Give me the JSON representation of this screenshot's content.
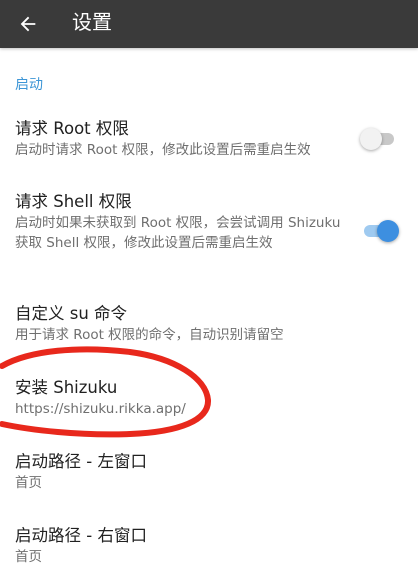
{
  "appbar": {
    "back_icon": "arrow-left-icon",
    "title": "设置"
  },
  "category": {
    "label": "启动",
    "color": "#3d96d6"
  },
  "prefs": [
    {
      "title": "请求 Root 权限",
      "summary": "启动时请求 Root 权限，修改此设置后需重启生效",
      "switch": "off"
    },
    {
      "title": "请求 Shell 权限",
      "summary": "启动时如果未获取到 Root 权限，会尝试调用 Shizuku 获取 Shell 权限，修改此设置后需重启生效",
      "switch": "on"
    },
    {
      "title": "自定义 su 命令",
      "summary": "用于请求 Root 权限的命令，自动识别请留空"
    },
    {
      "title": "安装 Shizuku",
      "summary": "https://shizuku.rikka.app/"
    },
    {
      "title": "启动路径 - 左窗口",
      "summary": "首页"
    },
    {
      "title": "启动路径 - 右窗口",
      "summary": "首页"
    }
  ],
  "colors": {
    "appbar": "#3a3a3a",
    "accent": "#3d8fe0",
    "annotation": "#e8281c"
  }
}
